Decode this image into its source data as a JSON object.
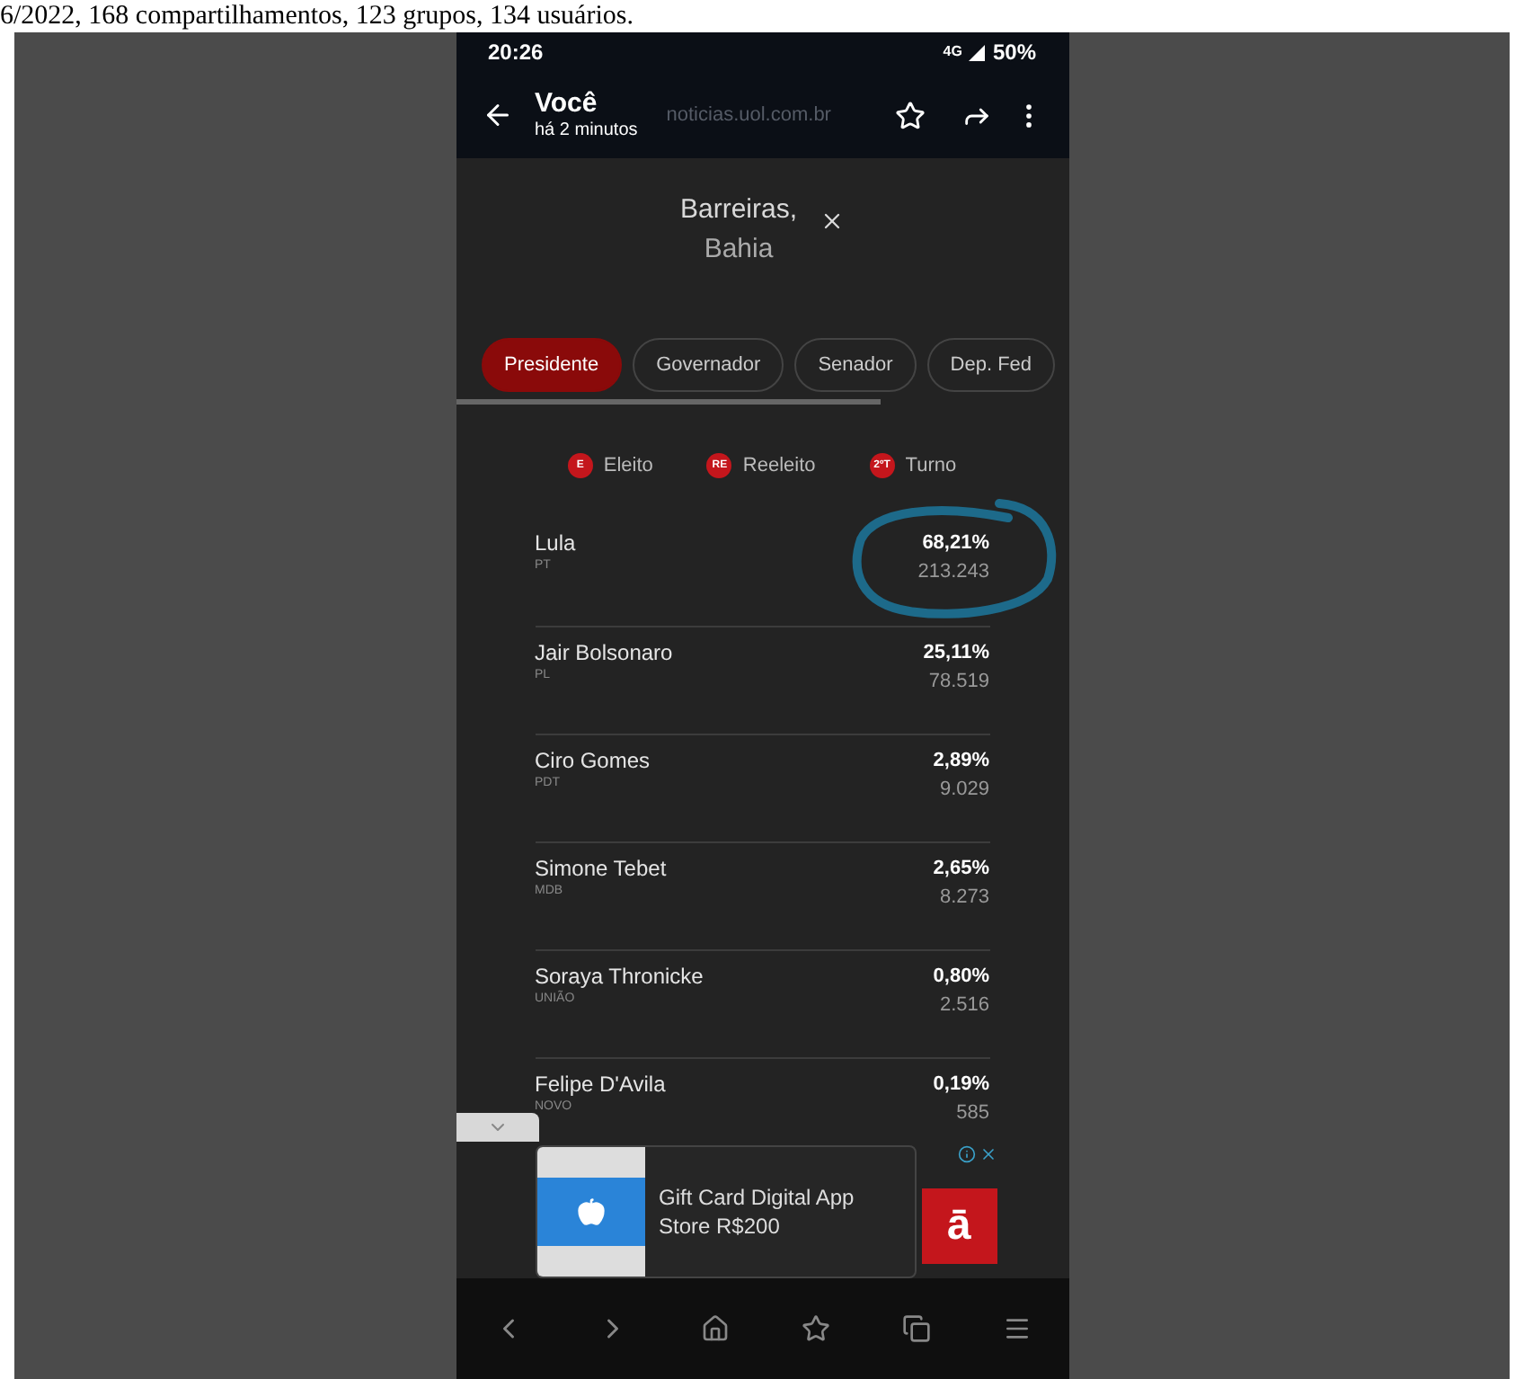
{
  "caption": "6/2022, 168 compartilhamentos, 123 grupos, 134 usuários.",
  "status_bar": {
    "time": "20:26",
    "network": "4G",
    "battery": "50%"
  },
  "toolbar": {
    "title": "Você",
    "subtitle": "há 2 minutos",
    "url": "noticias.uol.com.br"
  },
  "location": {
    "city": "Barreiras,",
    "state": "Bahia"
  },
  "tabs": [
    {
      "label": "Presidente",
      "selected": true
    },
    {
      "label": "Governador",
      "selected": false
    },
    {
      "label": "Senador",
      "selected": false
    },
    {
      "label": "Dep. Fed",
      "selected": false
    }
  ],
  "legend": [
    {
      "badge": "E",
      "label": "Eleito"
    },
    {
      "badge": "RE",
      "label": "Reeleito"
    },
    {
      "badge": "2ºT",
      "label": "Turno"
    }
  ],
  "candidates": [
    {
      "name": "Lula",
      "party": "PT",
      "percent": "68,21%",
      "votes": "213.243",
      "circled": true
    },
    {
      "name": "Jair Bolsonaro",
      "party": "PL",
      "percent": "25,11%",
      "votes": "78.519",
      "circled": false
    },
    {
      "name": "Ciro Gomes",
      "party": "PDT",
      "percent": "2,89%",
      "votes": "9.029",
      "circled": false
    },
    {
      "name": "Simone Tebet",
      "party": "MDB",
      "percent": "2,65%",
      "votes": "8.273",
      "circled": false
    },
    {
      "name": "Soraya Thronicke",
      "party": "UNIÃO",
      "percent": "0,80%",
      "votes": "2.516",
      "circled": false
    },
    {
      "name": "Felipe D'Avila",
      "party": "NOVO",
      "percent": "0,19%",
      "votes": "585",
      "circled": false
    }
  ],
  "ad": {
    "text": "Gift Card Digital App Store R$200",
    "logo": "ā"
  }
}
